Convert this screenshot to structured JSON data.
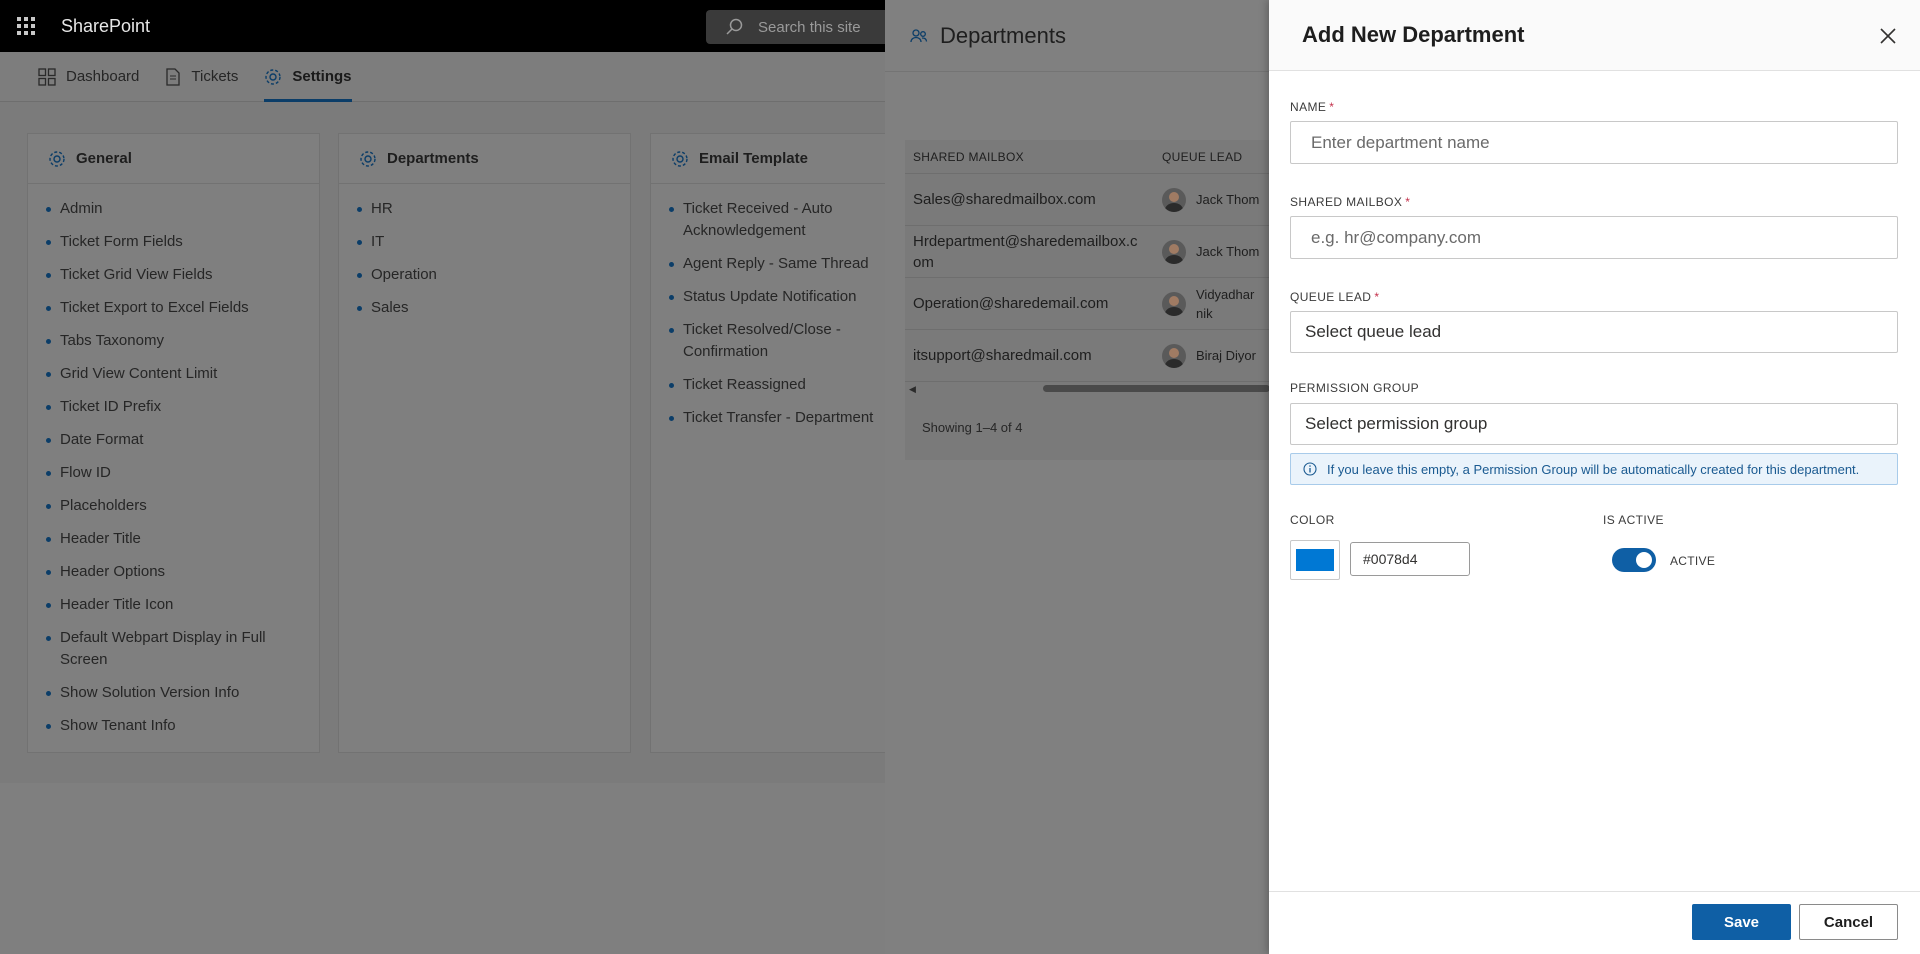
{
  "suitebar": {
    "app_name": "SharePoint",
    "search_placeholder": "Search this site"
  },
  "tabs": [
    {
      "label": "Dashboard",
      "icon": "dashboard-icon"
    },
    {
      "label": "Tickets",
      "icon": "document-icon"
    },
    {
      "label": "Settings",
      "icon": "gear-icon",
      "active": true
    }
  ],
  "cards": {
    "general": {
      "title": "General",
      "items": [
        "Admin",
        "Ticket Form Fields",
        "Ticket Grid View Fields",
        "Ticket Export to Excel Fields",
        "Tabs Taxonomy",
        "Grid View Content Limit",
        "Ticket ID Prefix",
        "Date Format",
        "Flow ID",
        "Placeholders",
        "Header Title",
        "Header Options",
        "Header Title Icon",
        "Default Webpart Display in Full Screen",
        "Show Solution Version Info",
        "Show Tenant Info"
      ]
    },
    "departments": {
      "title": "Departments",
      "items": [
        "HR",
        "IT",
        "Operation",
        "Sales"
      ]
    },
    "email_template": {
      "title": "Email Template",
      "items": [
        "Ticket Received - Auto Acknowledgement",
        "Agent Reply - Same Thread",
        "Status Update Notification",
        "Ticket Resolved/Close - Confirmation",
        "Ticket Reassigned",
        "Ticket Transfer - Department"
      ]
    }
  },
  "dept_list": {
    "title": "Departments",
    "columns": {
      "mailbox": "SHARED MAILBOX",
      "lead": "QUEUE LEAD"
    },
    "rows": [
      {
        "mailbox": "Sales@sharedmailbox.com",
        "lead": "Jack Thom"
      },
      {
        "mailbox": "Hrdepartment@sharedemailbox.com",
        "lead": "Jack Thom"
      },
      {
        "mailbox": "Operation@sharedemail.com",
        "lead": "Vidyadharnik"
      },
      {
        "mailbox": "itsupport@sharedmail.com",
        "lead": "Biraj Diyor"
      }
    ],
    "footer": "Showing 1–4 of 4"
  },
  "panel": {
    "title": "Add New Department",
    "name_label": "NAME",
    "name_placeholder": "Enter department name",
    "mailbox_label": "SHARED MAILBOX",
    "mailbox_placeholder": "e.g. hr@company.com",
    "lead_label": "QUEUE LEAD",
    "lead_placeholder": "Select queue lead",
    "group_label": "PERMISSION GROUP",
    "group_placeholder": "Select permission group",
    "info_text": "If you leave this empty, a Permission Group will be automatically created for this department.",
    "color_label": "COLOR",
    "color_value": "#0078d4",
    "active_label": "IS ACTIVE",
    "active_state": "ACTIVE",
    "save_label": "Save",
    "cancel_label": "Cancel"
  }
}
